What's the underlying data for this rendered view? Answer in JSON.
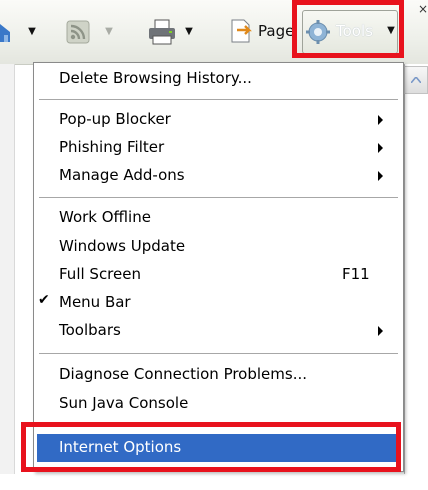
{
  "toolbar": {
    "page_label": "Page",
    "tools_label": "Tools",
    "close_mark": "×"
  },
  "menu": {
    "items": [
      {
        "label": "Delete Browsing History..."
      },
      {
        "label": "Pop-up Blocker"
      },
      {
        "label": "Phishing Filter"
      },
      {
        "label": "Manage Add-ons"
      },
      {
        "label": "Work Offline"
      },
      {
        "label": "Windows Update"
      },
      {
        "label": "Full Screen",
        "shortcut": "F11"
      },
      {
        "label": "Menu Bar",
        "check": "✔"
      },
      {
        "label": "Toolbars"
      },
      {
        "label": "Diagnose Connection Problems..."
      },
      {
        "label": "Sun Java Console"
      },
      {
        "label": "Internet Options"
      }
    ]
  },
  "colors": {
    "highlight": "#316ac5",
    "annotation_red": "#e8121d"
  }
}
